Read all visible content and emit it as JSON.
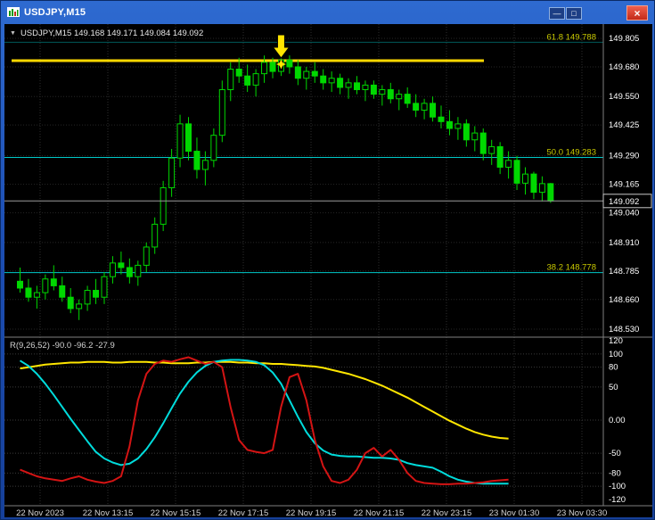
{
  "window": {
    "title": "USDJPY,M15",
    "controls": {
      "minimize_glyph": "—",
      "restore_glyph": "□",
      "close_glyph": "×"
    }
  },
  "chart_data": [
    {
      "type": "candlestick",
      "symbol": "USDJPY",
      "timeframe": "M15",
      "header": "USDJPY,M15 149.168 149.171 149.084 149.092",
      "ohlc_readout": {
        "open": 149.168,
        "high": 149.171,
        "low": 149.084,
        "close": 149.092
      },
      "candle_color": "#00d800",
      "price_axis": {
        "labels": [
          "149.805",
          "149.680",
          "149.550",
          "149.425",
          "149.290",
          "149.165",
          "149.040",
          "148.910",
          "148.785",
          "148.660",
          "148.530"
        ],
        "values": [
          149.805,
          149.68,
          149.55,
          149.425,
          149.29,
          149.165,
          149.04,
          148.91,
          148.785,
          148.66,
          148.53
        ],
        "min": 148.53,
        "max": 149.805
      },
      "current_price": 149.092,
      "fib_color": "#00c8c8",
      "fib_label_color": "#c8c800",
      "fib_levels": [
        {
          "label": "61.8",
          "price": 149.788
        },
        {
          "label": "50.0",
          "price": 149.283
        },
        {
          "label": "38.2",
          "price": 148.778
        }
      ],
      "resistance_line": {
        "price": 149.707,
        "color": "#ffd800"
      },
      "arrow": {
        "candle_index": 31,
        "color": "#ffe400"
      },
      "x_labels": [
        "22 Nov 2023",
        "22 Nov 13:15",
        "22 Nov 15:15",
        "22 Nov 17:15",
        "22 Nov 19:15",
        "22 Nov 21:15",
        "22 Nov 23:15",
        "23 Nov 01:30",
        "23 Nov 03:30"
      ],
      "candles": [
        [
          148.74,
          148.8,
          148.69,
          148.71
        ],
        [
          148.71,
          148.75,
          148.65,
          148.67
        ],
        [
          148.67,
          148.72,
          148.62,
          148.69
        ],
        [
          148.69,
          148.77,
          148.66,
          148.75
        ],
        [
          148.75,
          148.81,
          148.7,
          148.72
        ],
        [
          148.72,
          148.76,
          148.65,
          148.67
        ],
        [
          148.67,
          148.71,
          148.6,
          148.62
        ],
        [
          148.62,
          148.66,
          148.57,
          148.64
        ],
        [
          148.64,
          148.72,
          148.61,
          148.7
        ],
        [
          148.7,
          148.75,
          148.64,
          148.67
        ],
        [
          148.67,
          148.78,
          148.64,
          148.76
        ],
        [
          148.76,
          148.85,
          148.73,
          148.82
        ],
        [
          148.82,
          148.87,
          148.77,
          148.8
        ],
        [
          148.8,
          148.84,
          148.73,
          148.76
        ],
        [
          148.76,
          148.83,
          148.72,
          148.81
        ],
        [
          148.81,
          148.91,
          148.78,
          148.89
        ],
        [
          148.89,
          149.02,
          148.86,
          148.99
        ],
        [
          148.99,
          149.18,
          148.96,
          149.15
        ],
        [
          149.15,
          149.32,
          149.11,
          149.28
        ],
        [
          149.28,
          149.47,
          149.24,
          149.43
        ],
        [
          149.43,
          149.46,
          149.27,
          149.31
        ],
        [
          149.31,
          149.37,
          149.19,
          149.23
        ],
        [
          149.23,
          149.31,
          149.16,
          149.27
        ],
        [
          149.27,
          149.41,
          149.24,
          149.38
        ],
        [
          149.38,
          149.62,
          149.35,
          149.58
        ],
        [
          149.58,
          149.7,
          149.53,
          149.67
        ],
        [
          149.67,
          149.72,
          149.61,
          149.64
        ],
        [
          149.64,
          149.69,
          149.57,
          149.6
        ],
        [
          149.6,
          149.67,
          149.55,
          149.65
        ],
        [
          149.65,
          149.73,
          149.61,
          149.7
        ],
        [
          149.7,
          149.72,
          149.63,
          149.66
        ],
        [
          149.66,
          149.735,
          149.64,
          149.71
        ],
        [
          149.71,
          149.73,
          149.65,
          149.68
        ],
        [
          149.68,
          149.71,
          149.6,
          149.63
        ],
        [
          149.63,
          149.68,
          149.58,
          149.66
        ],
        [
          149.66,
          149.7,
          149.61,
          149.64
        ],
        [
          149.64,
          149.67,
          149.58,
          149.61
        ],
        [
          149.61,
          149.66,
          149.57,
          149.63
        ],
        [
          149.63,
          149.65,
          149.56,
          149.59
        ],
        [
          149.59,
          149.63,
          149.54,
          149.61
        ],
        [
          149.61,
          149.64,
          149.56,
          149.58
        ],
        [
          149.58,
          149.62,
          149.53,
          149.6
        ],
        [
          149.6,
          149.62,
          149.54,
          149.56
        ],
        [
          149.56,
          149.6,
          149.51,
          149.58
        ],
        [
          149.58,
          149.61,
          149.52,
          149.54
        ],
        [
          149.54,
          149.58,
          149.49,
          149.56
        ],
        [
          149.56,
          149.59,
          149.5,
          149.52
        ],
        [
          149.52,
          149.56,
          149.46,
          149.49
        ],
        [
          149.49,
          149.54,
          149.45,
          149.52
        ],
        [
          149.52,
          149.55,
          149.44,
          149.46
        ],
        [
          149.46,
          149.51,
          149.41,
          149.44
        ],
        [
          149.44,
          149.49,
          149.38,
          149.41
        ],
        [
          149.41,
          149.46,
          149.36,
          149.43
        ],
        [
          149.43,
          149.45,
          149.33,
          149.36
        ],
        [
          149.36,
          149.42,
          149.31,
          149.39
        ],
        [
          149.39,
          149.41,
          149.27,
          149.3
        ],
        [
          149.3,
          149.36,
          149.25,
          149.33
        ],
        [
          149.33,
          149.35,
          149.21,
          149.24
        ],
        [
          149.24,
          149.31,
          149.19,
          149.27
        ],
        [
          149.27,
          149.29,
          149.14,
          149.17
        ],
        [
          149.17,
          149.24,
          149.12,
          149.21
        ],
        [
          149.21,
          149.22,
          149.1,
          149.13
        ],
        [
          149.13,
          149.2,
          149.09,
          149.168
        ],
        [
          149.168,
          149.171,
          149.084,
          149.092
        ]
      ]
    },
    {
      "type": "line",
      "label": "R(9,26,52) -90.0 -96.2 -27.9",
      "y_axis": {
        "labels": [
          "120",
          "100",
          "80",
          "50",
          "0.00",
          "-50",
          "-80",
          "-100",
          "-120"
        ],
        "values": [
          120,
          100,
          80,
          50,
          0,
          -50,
          -80,
          -100,
          -120
        ],
        "min": -120,
        "max": 120
      },
      "series": [
        {
          "name": "slow-yellow",
          "color": "#ffe600",
          "values": [
            78,
            80,
            82,
            84,
            85,
            86,
            87,
            87,
            88,
            88,
            88,
            87,
            87,
            88,
            88,
            88,
            87,
            87,
            86,
            86,
            86,
            87,
            87,
            88,
            88,
            88,
            87,
            87,
            86,
            86,
            85,
            85,
            84,
            83,
            82,
            81,
            79,
            76,
            73,
            70,
            66,
            62,
            57,
            52,
            46,
            40,
            34,
            27,
            20,
            13,
            6,
            -1,
            -7,
            -13,
            -18,
            -22,
            -25,
            -27,
            -27.9
          ]
        },
        {
          "name": "mid-cyan",
          "color": "#00dcdc",
          "values": [
            90,
            82,
            70,
            55,
            38,
            20,
            2,
            -15,
            -32,
            -48,
            -58,
            -64,
            -68,
            -66,
            -58,
            -44,
            -26,
            -5,
            18,
            40,
            58,
            72,
            82,
            88,
            90,
            91,
            91,
            90,
            88,
            83,
            72,
            55,
            30,
            5,
            -18,
            -35,
            -46,
            -52,
            -54,
            -55,
            -55,
            -56,
            -57,
            -57,
            -58,
            -60,
            -65,
            -68,
            -70,
            -72,
            -78,
            -85,
            -90,
            -93,
            -95,
            -96,
            -96.2,
            -96.2,
            -96.2
          ]
        },
        {
          "name": "fast-red",
          "color": "#d41414",
          "values": [
            -75,
            -80,
            -85,
            -88,
            -90,
            -92,
            -88,
            -85,
            -90,
            -93,
            -95,
            -92,
            -85,
            -40,
            30,
            70,
            85,
            90,
            88,
            92,
            95,
            90,
            85,
            88,
            80,
            20,
            -30,
            -45,
            -48,
            -50,
            -45,
            20,
            65,
            70,
            30,
            -30,
            -70,
            -92,
            -95,
            -90,
            -75,
            -50,
            -42,
            -55,
            -45,
            -60,
            -80,
            -92,
            -95,
            -96,
            -97,
            -97,
            -96,
            -96,
            -95,
            -94,
            -92,
            -91,
            -90
          ]
        }
      ]
    }
  ]
}
